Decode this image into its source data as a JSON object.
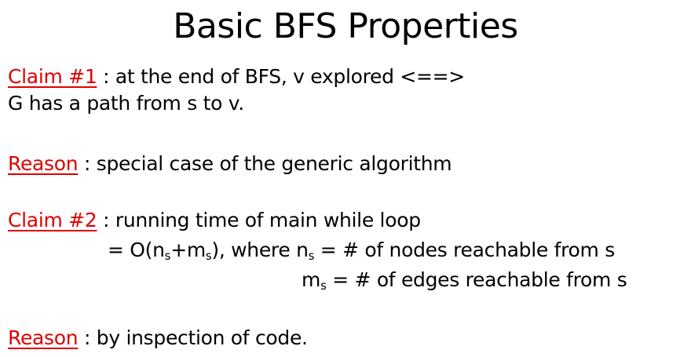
{
  "title": "Basic BFS Properties",
  "claim1": {
    "label": "Claim #1",
    "sep": " : ",
    "text": "at the end of BFS, v explored <==>",
    "cont": "G has a path from s to v."
  },
  "reason1": {
    "label": "Reason",
    "sep": " : ",
    "text": "special case of the generic algorithm"
  },
  "claim2": {
    "label": "Claim #2",
    "sep": " : ",
    "text": "running time of main while loop",
    "eq_a": "= O(n",
    "eq_s1": "s",
    "eq_b": "+m",
    "eq_s2": "s",
    "eq_c": "), where n",
    "eq_s3": "s",
    "eq_d": " = # of nodes reachable from s",
    "m_a": "m",
    "m_s": "s",
    "m_b": " = # of edges reachable from s"
  },
  "reason2": {
    "label": "Reason",
    "sep": " : ",
    "text": "by inspection of code."
  }
}
